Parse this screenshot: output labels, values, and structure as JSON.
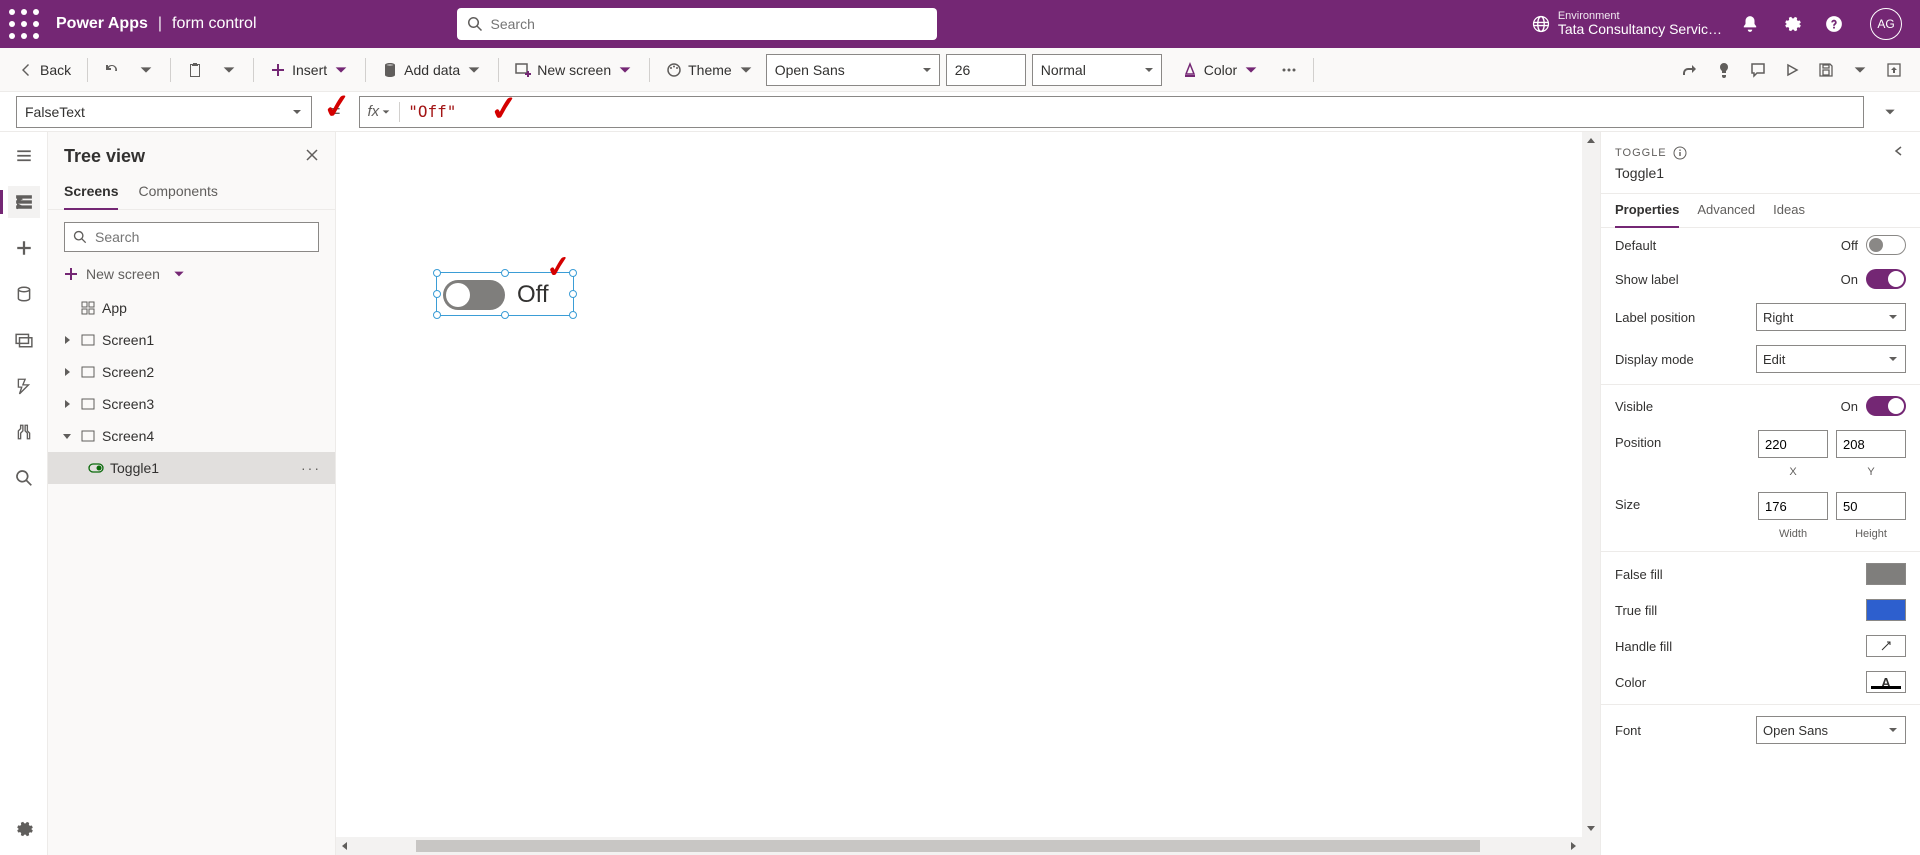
{
  "header": {
    "app_name": "Power Apps",
    "subtitle": "form control",
    "search_placeholder": "Search",
    "env_label": "Environment",
    "env_value": "Tata Consultancy Servic…",
    "avatar_initials": "AG"
  },
  "cmdbar": {
    "back": "Back",
    "insert": "Insert",
    "add_data": "Add data",
    "new_screen": "New screen",
    "theme": "Theme",
    "font": "Open Sans",
    "font_size": "26",
    "font_weight": "Normal",
    "color": "Color"
  },
  "formula": {
    "property": "FalseText",
    "value": "\"Off\""
  },
  "tree": {
    "title": "Tree view",
    "tab_screens": "Screens",
    "tab_components": "Components",
    "search_placeholder": "Search",
    "new_screen": "New screen",
    "app": "App",
    "screens": [
      "Screen1",
      "Screen2",
      "Screen3",
      "Screen4"
    ],
    "selected_child": "Toggle1"
  },
  "canvas": {
    "toggle_label": "Off"
  },
  "rightpanel": {
    "type_label": "TOGGLE",
    "name": "Toggle1",
    "tab_properties": "Properties",
    "tab_advanced": "Advanced",
    "tab_ideas": "Ideas",
    "default_label": "Default",
    "default_state": "Off",
    "show_label": "Show label",
    "show_label_state": "On",
    "label_position": "Label position",
    "label_position_value": "Right",
    "display_mode": "Display mode",
    "display_mode_value": "Edit",
    "visible": "Visible",
    "visible_state": "On",
    "position": "Position",
    "pos_x": "220",
    "pos_y": "208",
    "x_label": "X",
    "y_label": "Y",
    "size": "Size",
    "width": "176",
    "height": "50",
    "width_label": "Width",
    "height_label": "Height",
    "false_fill": "False fill",
    "true_fill": "True fill",
    "handle_fill": "Handle fill",
    "color_label": "Color",
    "font_label": "Font",
    "font_value": "Open Sans"
  }
}
